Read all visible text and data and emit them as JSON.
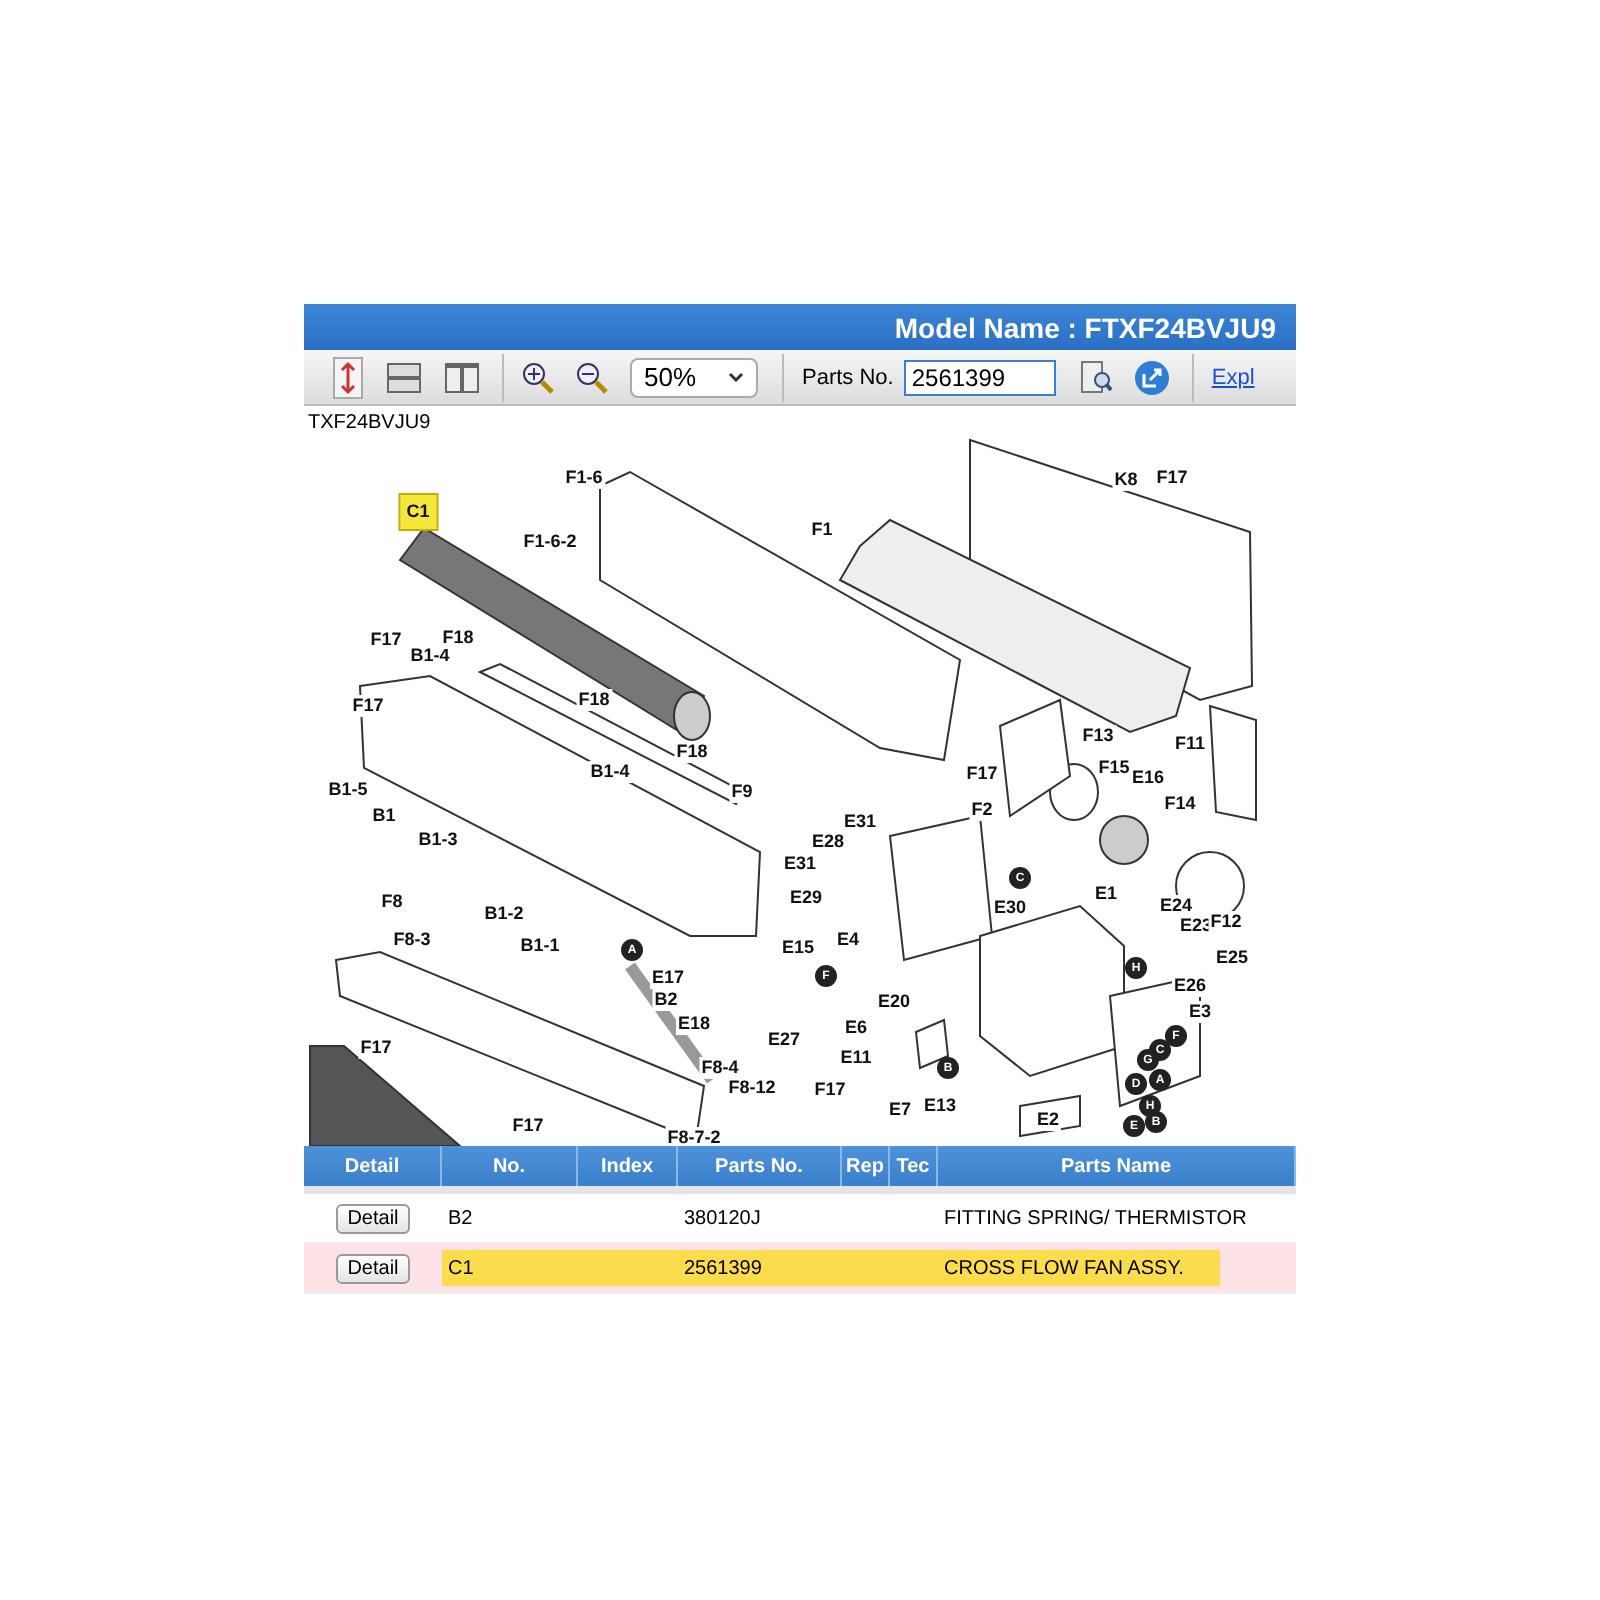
{
  "header": {
    "title": "Model Name : FTXF24BVJU9"
  },
  "toolbar": {
    "zoom": "50%",
    "parts_no_label": "Parts No.",
    "parts_no": "2561399",
    "link": "Expl"
  },
  "diagram": {
    "caption": "TXF24BVJU9",
    "callouts": [
      {
        "text": "C1",
        "kind": "label",
        "selected": true
      },
      {
        "text": "F1-6",
        "kind": "label",
        "selected": false
      },
      {
        "text": "F1-6-2",
        "kind": "label",
        "selected": false
      },
      {
        "text": "F1",
        "kind": "label",
        "selected": false
      },
      {
        "text": "K8",
        "kind": "label",
        "selected": false
      },
      {
        "text": "F17",
        "kind": "label",
        "selected": false
      },
      {
        "text": "F17",
        "kind": "label",
        "selected": false
      },
      {
        "text": "B1-4",
        "kind": "label",
        "selected": false
      },
      {
        "text": "F18",
        "kind": "label",
        "selected": false
      },
      {
        "text": "F18",
        "kind": "label",
        "selected": false
      },
      {
        "text": "F17",
        "kind": "label",
        "selected": false
      },
      {
        "text": "F18",
        "kind": "label",
        "selected": false
      },
      {
        "text": "B1-5",
        "kind": "label",
        "selected": false
      },
      {
        "text": "B1",
        "kind": "label",
        "selected": false
      },
      {
        "text": "B1-4",
        "kind": "label",
        "selected": false
      },
      {
        "text": "F9",
        "kind": "label",
        "selected": false
      },
      {
        "text": "B1-3",
        "kind": "label",
        "selected": false
      },
      {
        "text": "F17",
        "kind": "label",
        "selected": false
      },
      {
        "text": "F2",
        "kind": "label",
        "selected": false
      },
      {
        "text": "F13",
        "kind": "label",
        "selected": false
      },
      {
        "text": "F15",
        "kind": "label",
        "selected": false
      },
      {
        "text": "E16",
        "kind": "label",
        "selected": false
      },
      {
        "text": "F14",
        "kind": "label",
        "selected": false
      },
      {
        "text": "F11",
        "kind": "label",
        "selected": false
      },
      {
        "text": "E31",
        "kind": "label",
        "selected": false
      },
      {
        "text": "E28",
        "kind": "label",
        "selected": false
      },
      {
        "text": "E31",
        "kind": "label",
        "selected": false
      },
      {
        "text": "E29",
        "kind": "label",
        "selected": false
      },
      {
        "text": "E4",
        "kind": "label",
        "selected": false
      },
      {
        "text": "E30",
        "kind": "label",
        "selected": false
      },
      {
        "text": "E1",
        "kind": "label",
        "selected": false
      },
      {
        "text": "E24",
        "kind": "label",
        "selected": false
      },
      {
        "text": "E23",
        "kind": "label",
        "selected": false
      },
      {
        "text": "F12",
        "kind": "label",
        "selected": false
      },
      {
        "text": "E25",
        "kind": "label",
        "selected": false
      },
      {
        "text": "E26",
        "kind": "label",
        "selected": false
      },
      {
        "text": "E3",
        "kind": "label",
        "selected": false
      },
      {
        "text": "F8",
        "kind": "label",
        "selected": false
      },
      {
        "text": "F8-3",
        "kind": "label",
        "selected": false
      },
      {
        "text": "B1-2",
        "kind": "label",
        "selected": false
      },
      {
        "text": "B1-1",
        "kind": "label",
        "selected": false
      },
      {
        "text": "E17",
        "kind": "label",
        "selected": false
      },
      {
        "text": "B2",
        "kind": "label",
        "selected": false
      },
      {
        "text": "E18",
        "kind": "label",
        "selected": false
      },
      {
        "text": "E15",
        "kind": "label",
        "selected": false
      },
      {
        "text": "E27",
        "kind": "label",
        "selected": false
      },
      {
        "text": "E20",
        "kind": "label",
        "selected": false
      },
      {
        "text": "E6",
        "kind": "label",
        "selected": false
      },
      {
        "text": "E11",
        "kind": "label",
        "selected": false
      },
      {
        "text": "F17",
        "kind": "label",
        "selected": false
      },
      {
        "text": "F17",
        "kind": "label",
        "selected": false
      },
      {
        "text": "E7",
        "kind": "label",
        "selected": false
      },
      {
        "text": "E13",
        "kind": "label",
        "selected": false
      },
      {
        "text": "E2",
        "kind": "label",
        "selected": false
      },
      {
        "text": "F8-4",
        "kind": "label",
        "selected": false
      },
      {
        "text": "F8-12",
        "kind": "label",
        "selected": false
      },
      {
        "text": "F17",
        "kind": "label",
        "selected": false
      },
      {
        "text": "F8-7-2",
        "kind": "label",
        "selected": false
      },
      {
        "text": "A",
        "kind": "circle",
        "selected": false
      },
      {
        "text": "C",
        "kind": "circle",
        "selected": false
      },
      {
        "text": "F",
        "kind": "circle",
        "selected": false
      },
      {
        "text": "H",
        "kind": "circle",
        "selected": false
      },
      {
        "text": "B",
        "kind": "circle",
        "selected": false
      },
      {
        "text": "F",
        "kind": "circle",
        "selected": false
      },
      {
        "text": "C",
        "kind": "circle",
        "selected": false
      },
      {
        "text": "G",
        "kind": "circle",
        "selected": false
      },
      {
        "text": "A",
        "kind": "circle",
        "selected": false
      },
      {
        "text": "D",
        "kind": "circle",
        "selected": false
      },
      {
        "text": "H",
        "kind": "circle",
        "selected": false
      },
      {
        "text": "B",
        "kind": "circle",
        "selected": false
      },
      {
        "text": "E",
        "kind": "circle",
        "selected": false
      }
    ]
  },
  "table": {
    "columns": [
      "Detail",
      "No.",
      "Index",
      "Parts No.",
      "Rep",
      "Tec",
      "Parts Name"
    ],
    "rows": [
      {
        "button": "Detail",
        "no": "B2",
        "index": "",
        "parts_no": "380120J",
        "name": "FITTING SPRING/ THERMISTOR",
        "selected": false
      },
      {
        "button": "Detail",
        "no": "C1",
        "index": "",
        "parts_no": "2561399",
        "name": "CROSS FLOW FAN ASSY.",
        "selected": true
      }
    ]
  }
}
